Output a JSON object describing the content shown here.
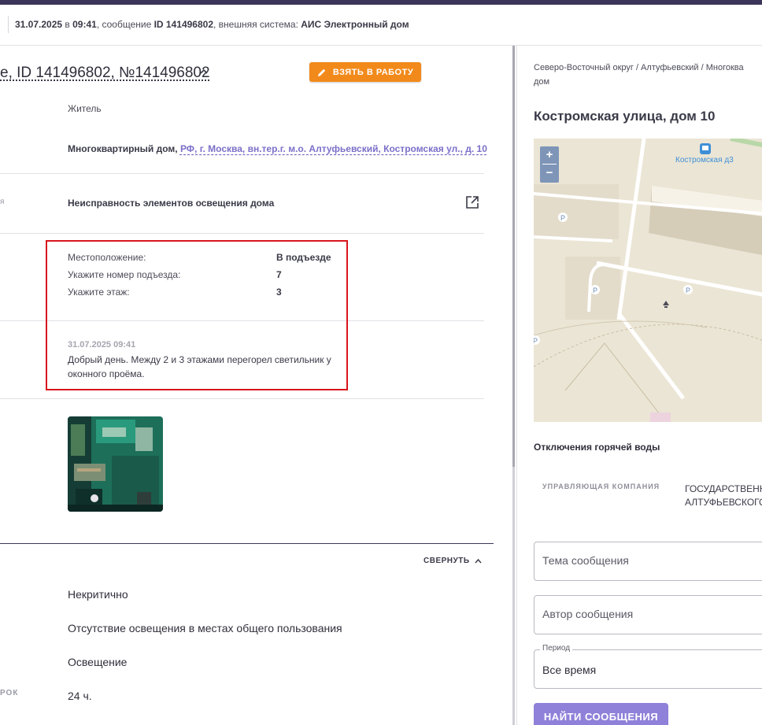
{
  "infobar": {
    "date": "31.07.2025",
    "in": " в ",
    "time": "09:41",
    "msg_prefix": ", сообщение ",
    "msg_id": "ID 141496802",
    "ext_prefix": ", внешняя система: ",
    "ext_system": "АИС Электронный дом"
  },
  "ticket": {
    "title": "е, ID 141496802, №141496802",
    "take_button": "ВЗЯТЬ В РАБОТУ",
    "author_type": "Житель",
    "object_type": "Многоквартирный дом, ",
    "object_address": "РФ, г. Москва, вн.тер.г. м.о. Алтуфьевский, Костромская ул., д. 10",
    "side_label_problem": "я",
    "problem": "Неисправность элементов освещения дома",
    "details": [
      {
        "label": "Местоположение:",
        "value": "В подъезде"
      },
      {
        "label": "Укажите номер подъезда:",
        "value": "7"
      },
      {
        "label": "Укажите этаж:",
        "value": "3"
      }
    ],
    "message_date": "31.07.2025 09:41",
    "message_text": "Добрый день. Между 2 и 3 этажами перегорел светильник у оконного проёма.",
    "collapse_label": "СВЕРНУТЬ",
    "criticality": "Некритично",
    "category": "Отсутствие освещения в местах общего пользования",
    "subcategory": "Освещение",
    "deadline_side_label": "РОК",
    "deadline": "24 ч."
  },
  "right": {
    "breadcrumb_line1": "Северо-Восточный округ / Алтуфьевский / Многоква",
    "breadcrumb_line2": "дом",
    "address": "Костромская улица, дом 10",
    "map": {
      "zoom_in": "+",
      "zoom_out": "−",
      "stop_label": "Костромская д3",
      "parking": "P"
    },
    "hot_water": "Отключения горячей воды",
    "mc_label": "УПРАВЛЯЮЩАЯ КОМПАНИЯ",
    "mc_value_line1": "ГОСУДАРСТВЕНН",
    "mc_value_line2": "АЛТУФЬЕВСКОГО",
    "topic_placeholder": "Тема сообщения",
    "author_placeholder": "Автор сообщения",
    "period_label": "Период",
    "period_value": "Все время",
    "find_button": "НАЙТИ СООБЩЕНИЯ"
  },
  "colors": {
    "accent_orange": "#f28a1b",
    "accent_purple": "#8f80d9",
    "highlight_red": "#d8151c",
    "header_dark": "#3b3559"
  }
}
